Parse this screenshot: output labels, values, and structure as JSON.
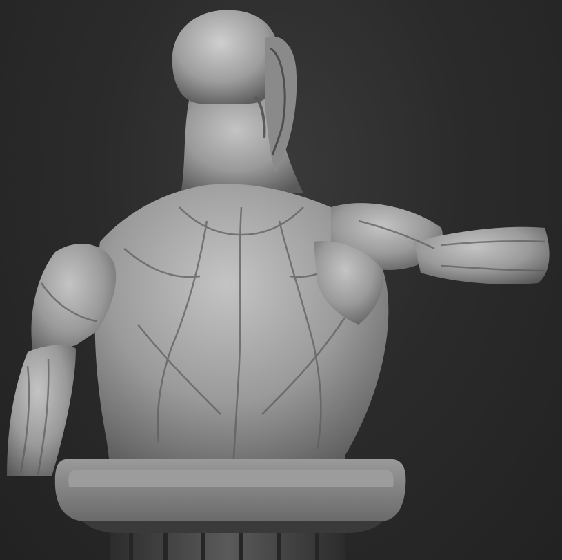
{
  "scene": {
    "subject": "ecorche-torso-back-view",
    "colors": {
      "background_center": "#3a3a3a",
      "background_edge": "#222222",
      "sculpt_light": "#bdbdbd",
      "sculpt_mid": "#8e8e8e",
      "sculpt_shadow": "#4a4a4a",
      "stand_top": "#8a8a8a",
      "stand_base": "#3a3a3a"
    }
  }
}
